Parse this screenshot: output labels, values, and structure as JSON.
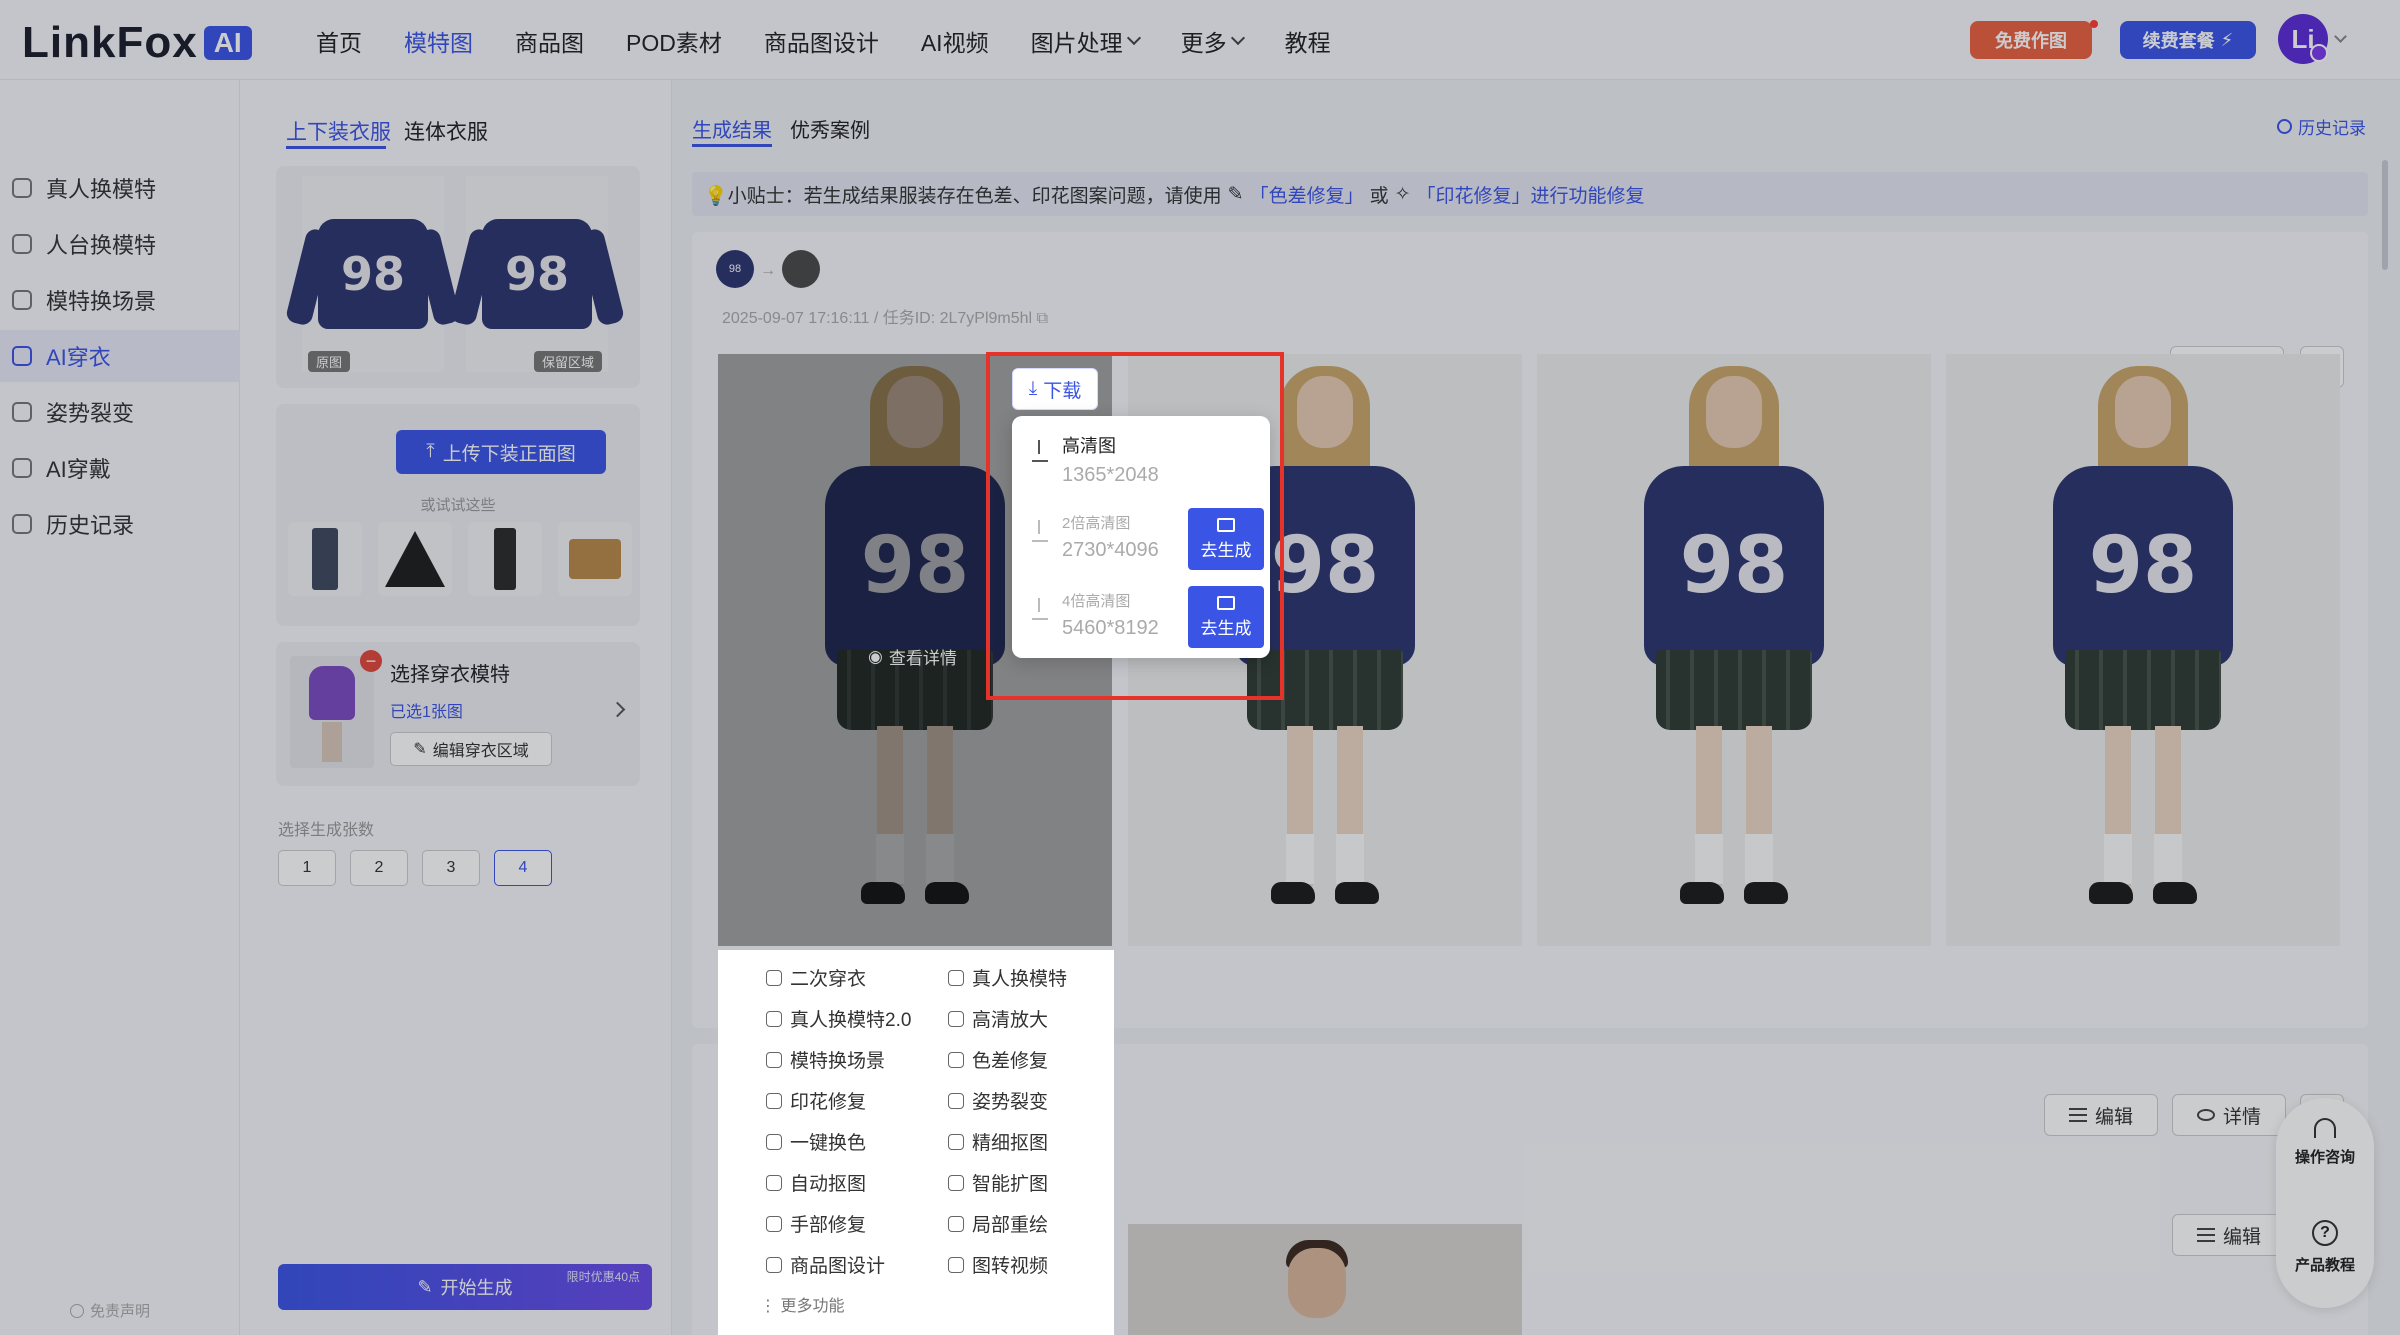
{
  "brand": {
    "logo_text": "LinkFox",
    "logo_ai": "AI"
  },
  "nav": {
    "items": [
      {
        "label": "首页",
        "active": false,
        "dropdown": false
      },
      {
        "label": "模特图",
        "active": true,
        "dropdown": false
      },
      {
        "label": "商品图",
        "active": false,
        "dropdown": false
      },
      {
        "label": "POD素材",
        "active": false,
        "dropdown": false
      },
      {
        "label": "商品图设计",
        "active": false,
        "dropdown": false
      },
      {
        "label": "AI视频",
        "active": false,
        "dropdown": false
      },
      {
        "label": "图片处理",
        "active": false,
        "dropdown": true
      },
      {
        "label": "更多",
        "active": false,
        "dropdown": true
      },
      {
        "label": "教程",
        "active": false,
        "dropdown": false
      }
    ],
    "free_label": "免费作图",
    "renew_label": "续费套餐",
    "avatar_text": "Li"
  },
  "sidebar": {
    "items": [
      {
        "label": "真人换模特",
        "icon": "swap-icon"
      },
      {
        "label": "人台换模特",
        "icon": "mannequin-icon"
      },
      {
        "label": "模特换场景",
        "icon": "scene-icon"
      },
      {
        "label": "AI穿衣",
        "icon": "shirt-icon",
        "active": true
      },
      {
        "label": "姿势裂变",
        "icon": "pose-icon"
      },
      {
        "label": "AI穿戴",
        "icon": "accessory-icon"
      },
      {
        "label": "历史记录",
        "icon": "history-icon"
      }
    ],
    "disclaimer": "免责声明"
  },
  "panel": {
    "tabs": [
      "上下装衣服",
      "连体衣服"
    ],
    "garment_tags": [
      "原图",
      "保留区域"
    ],
    "garment_number": "98",
    "upload_label": "上传下装正面图",
    "try_label": "或试试这些",
    "model": {
      "title": "选择穿衣模特",
      "selected": "已选1张图",
      "edit_label": "编辑穿衣区域"
    },
    "count_label": "选择生成张数",
    "counts": [
      "1",
      "2",
      "3",
      "4"
    ],
    "selected_count": "4",
    "start_label": "开始生成",
    "start_badge": "限时优惠40点"
  },
  "main": {
    "tabs": [
      "生成结果",
      "优秀案例"
    ],
    "history_label": "历史记录",
    "tip": {
      "prefix": "💡小贴士：若生成结果服装存在色差、印花图案问题，请使用",
      "link1": "「色差修复」",
      "mid": "或",
      "link2": "「印花修复」进行功能修复"
    },
    "task_meta": "2025-09-07 17:16:11 / 任务ID: 2L7yPl9m5hl",
    "edit_label": "编辑",
    "detail_label": "详情",
    "view_detail": "查看详情",
    "shirt_number": "98",
    "download": {
      "button_label": "下载",
      "options": [
        {
          "title": "高清图",
          "size": "1365*2048"
        },
        {
          "title": "2倍高清图",
          "size": "2730*4096",
          "action": "去生成"
        },
        {
          "title": "4倍高清图",
          "size": "5460*8192",
          "action": "去生成"
        }
      ]
    },
    "functions": [
      "二次穿衣",
      "真人换模特",
      "真人换模特2.0",
      "高清放大",
      "模特换场景",
      "色差修复",
      "印花修复",
      "姿势裂变",
      "一键换色",
      "精细抠图",
      "自动抠图",
      "智能扩图",
      "手部修复",
      "局部重绘",
      "商品图设计",
      "图转视频"
    ],
    "more_functions": "更多功能"
  },
  "float": {
    "consult": "操作咨询",
    "tutorial": "产品教程"
  }
}
